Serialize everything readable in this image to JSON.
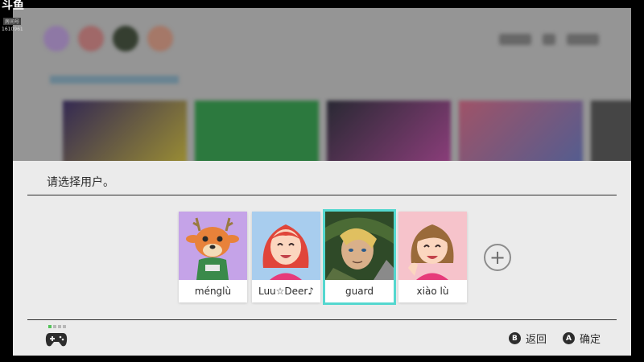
{
  "watermark": {
    "logo": "斗鱼",
    "subtitle": "房间号",
    "room_id": "1610961"
  },
  "panel": {
    "title": "请选择用户。"
  },
  "users": [
    {
      "name": "ménglù",
      "avatar": "deer-villager-avatar",
      "bg": "#c5a3e8",
      "selected": false
    },
    {
      "name": "Luu☆Deer♪",
      "avatar": "mii-red-hair-avatar",
      "bg": "#a8cdee",
      "selected": false
    },
    {
      "name": "guard",
      "avatar": "link-portrait-avatar",
      "bg": "#3d5d30",
      "selected": true
    },
    {
      "name": "xiào lù",
      "avatar": "mii-brown-hair-avatar",
      "bg": "#f6c3cb",
      "selected": false
    }
  ],
  "add_user": {
    "icon": "plus-icon",
    "glyph": "+"
  },
  "footer": {
    "back": {
      "key": "B",
      "label": "返回"
    },
    "confirm": {
      "key": "A",
      "label": "确定"
    }
  },
  "colors": {
    "accent": "#54d7cf",
    "panel_bg": "#ebebeb",
    "text": "#2d2d2d"
  }
}
